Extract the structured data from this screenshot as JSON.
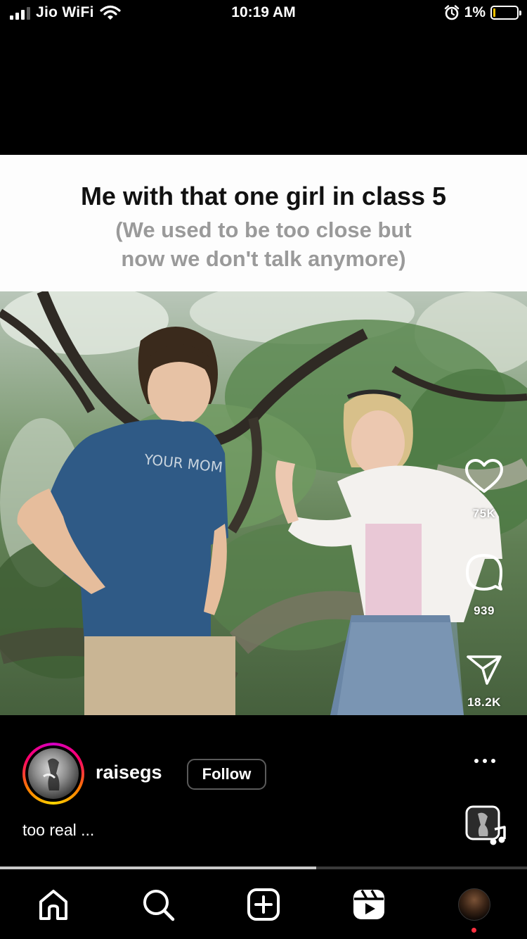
{
  "status_bar": {
    "carrier": "Jio WiFi",
    "time": "10:19 AM",
    "battery": "1%",
    "icons": [
      "signal-bars-icon",
      "wifi-icon",
      "alarm-icon",
      "battery-icon"
    ],
    "battery_level_fraction": 0.01
  },
  "post": {
    "meme_title": "Me with that one girl in class 5",
    "meme_subtitle_line1": "(We used to be too close but",
    "meme_subtitle_line2": "now we don't talk anymore)",
    "shirt_text": "YOUR MOM",
    "username": "raisegs",
    "follow_label": "Follow",
    "caption": "too real ...",
    "progress_fraction": 0.6
  },
  "actions": {
    "likes": "75K",
    "comments": "939",
    "shares": "18.2K",
    "icons": [
      "heart-icon",
      "comment-icon",
      "send-icon",
      "more-icon"
    ]
  },
  "nav": {
    "items": [
      "home-icon",
      "search-icon",
      "create-icon",
      "reels-icon",
      "profile-avatar"
    ]
  },
  "colors": {
    "background": "#000000",
    "caption_bg": "#fdfdfd",
    "notification": "#ff3040"
  }
}
